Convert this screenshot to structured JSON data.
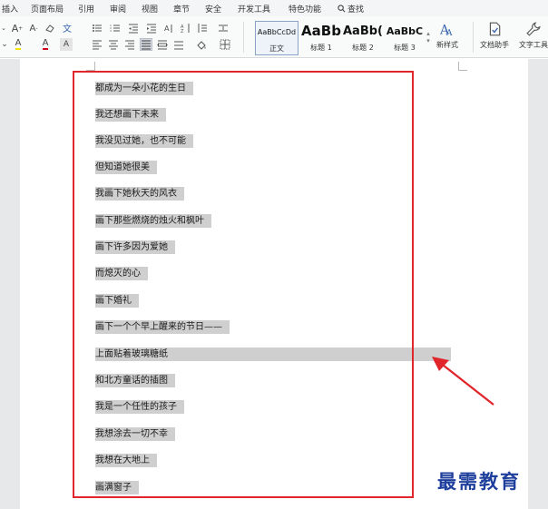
{
  "menu": {
    "items": [
      "插入",
      "页面布局",
      "引用",
      "审阅",
      "视图",
      "章节",
      "安全",
      "开发工具",
      "特色功能"
    ],
    "search_label": "查找"
  },
  "ribbon": {
    "styles": [
      {
        "sample": "AaBbCcDd",
        "label": "正文"
      },
      {
        "sample": "AaBb",
        "label": "标题 1"
      },
      {
        "sample": "AaBb(",
        "label": "标题 2"
      },
      {
        "sample": "AaBbC",
        "label": "标题 3"
      }
    ],
    "new_style_label": "新样式",
    "doc_assistant_label": "文档助手",
    "text_tools_label": "文字工具"
  },
  "document": {
    "lines": [
      "都成为一朵小花的生日",
      "我还想画下未来",
      "我没见过她，也不可能",
      "但知道她很美",
      "我画下她秋天的风衣",
      "画下那些燃烧的烛火和枫叶",
      "画下许多因为爱她",
      "而熄灭的心",
      "画下婚礼",
      "画下一个个早上醒来的节日——",
      "上面贴着玻璃糖纸",
      "和北方童话的插图",
      "我是一个任性的孩子",
      "我想涂去一切不幸",
      "我想在大地上",
      "画满窗子"
    ],
    "selection_fill": "#cfcfcf"
  },
  "annotation": {
    "box_color": "#e0262b",
    "arrow_color": "#e0262b"
  },
  "watermark": {
    "text": "最需教育",
    "color": "#1f3f9c"
  }
}
